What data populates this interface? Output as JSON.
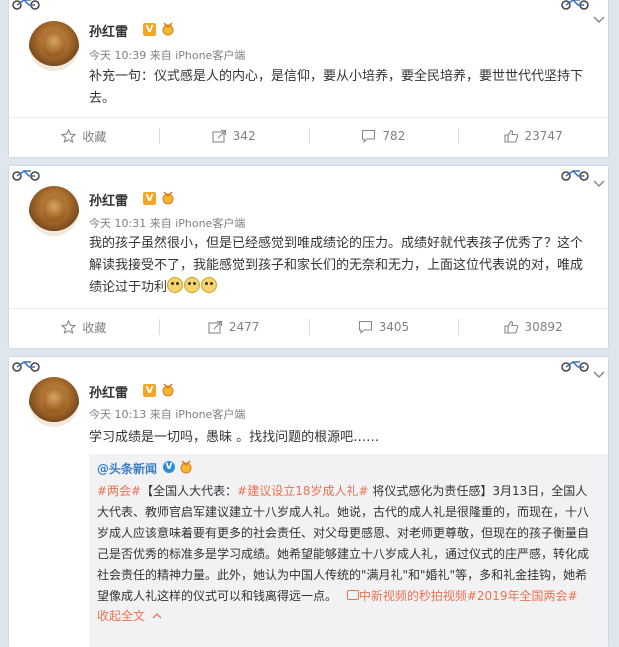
{
  "posts": [
    {
      "author": "孙红雷",
      "time": "今天 10:39",
      "source": "来自 iPhone客户端",
      "text": "补充一句：仪式感是人的内心，是信仰，要从小培养，要全民培养，要世世代代坚持下去。",
      "actions": {
        "fav": "收藏",
        "repost": "342",
        "comment": "782",
        "like": "23747"
      }
    },
    {
      "author": "孙红雷",
      "time": "今天 10:31",
      "source": "来自 iPhone客户端",
      "text": "我的孩子虽然很小，但是已经感觉到唯成绩论的压力。成绩好就代表孩子优秀了？这个解读我接受不了，我能感觉到孩子和家长们的无奈和无力，上面这位代表说的对，唯成绩论过于功利",
      "actions": {
        "fav": "收藏",
        "repost": "2477",
        "comment": "3405",
        "like": "30892"
      }
    },
    {
      "author": "孙红雷",
      "time": "今天 10:13",
      "source": "来自 iPhone客户端",
      "text": "学习成绩是一切吗，愚昧 。找找问题的根源吧……",
      "retweet": {
        "author": "@头条新闻",
        "tag1": "#两会#",
        "part1": "【全国人大代表：",
        "tag2": "#建议设立18岁成人礼#",
        "part2": " 将仪式感化为责任感】3月13日，全国人大代表、教师官启军建议建立十八岁成人礼。她说，古代的成人礼是很隆重的，而现在，十八岁成人应该意味着要有更多的社会责任、对父母更感恩、对老师更尊敬，但现在的孩子衡量自己是否优秀的标准多是学习成绩。她希望能够建立十八岁成人礼，通过仪式的庄严感，转化成社会责任的精神力量。此外，她认为中国人传统的\"满月礼\"和\"婚礼\"等，多和礼金挂钩，她希望像成人礼这样的仪式可以和钱离得远一点。",
        "link": "中新视频的秒拍视频",
        "tag3": "#2019年全国两会#",
        "collapse": "收起全文"
      }
    }
  ]
}
